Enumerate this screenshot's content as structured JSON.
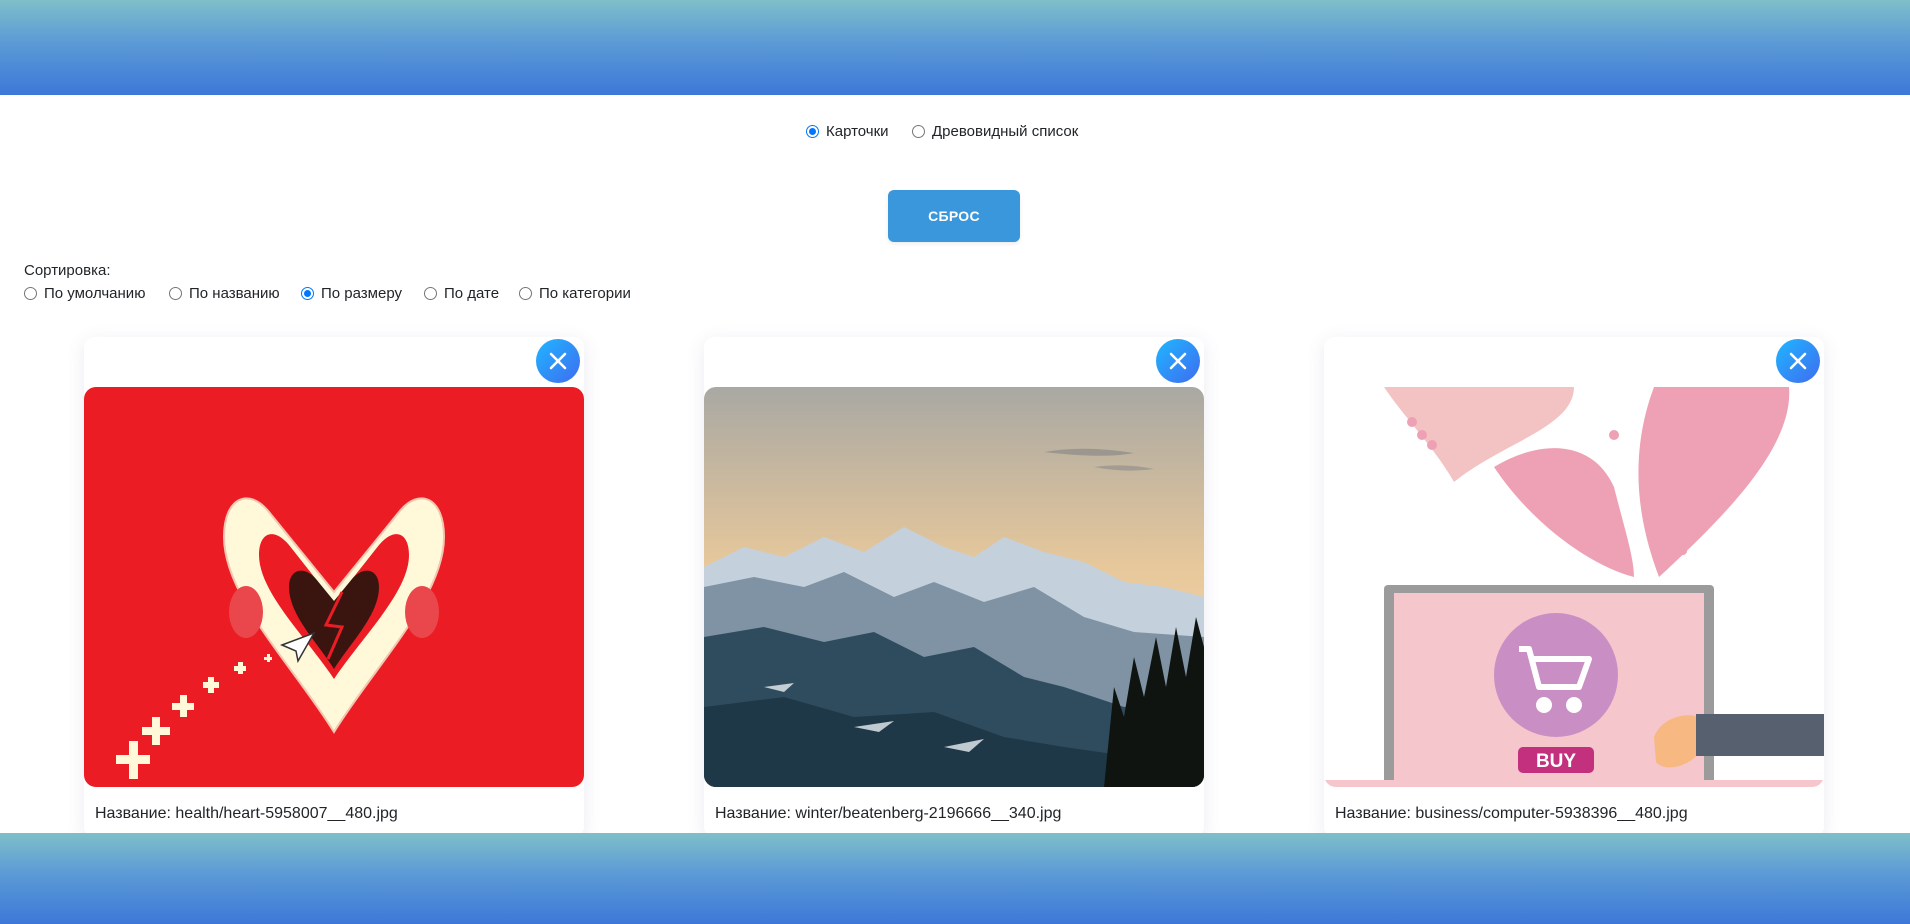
{
  "view_mode": {
    "options": [
      {
        "label": "Карточки",
        "checked": true
      },
      {
        "label": "Древовидный список",
        "checked": false
      }
    ]
  },
  "reset_button": {
    "label": "СБРОС"
  },
  "sort": {
    "label": "Сортировка:",
    "options": [
      {
        "label": "По умолчанию",
        "checked": false
      },
      {
        "label": "По названию",
        "checked": false
      },
      {
        "label": "По размеру",
        "checked": true
      },
      {
        "label": "По дате",
        "checked": false
      },
      {
        "label": "По категории",
        "checked": false
      }
    ]
  },
  "cards": [
    {
      "caption": "Название: health/heart-5958007__480.jpg",
      "image": "broken-heart-illustration",
      "icon": "close-icon"
    },
    {
      "caption": "Название: winter/beatenberg-2196666__340.jpg",
      "image": "mountain-landscape-photo",
      "icon": "close-icon"
    },
    {
      "caption": "Название: business/computer-5938396__480.jpg",
      "image": "online-shopping-illustration",
      "icon": "close-icon"
    }
  ],
  "colors": {
    "accent": "#0075ff",
    "button": "#3a97dc",
    "close_gradient_start": "#1fb6ff",
    "close_gradient_end": "#3f6cf0",
    "band_start": "#7fbfc9",
    "band_end": "#3d78d8"
  }
}
